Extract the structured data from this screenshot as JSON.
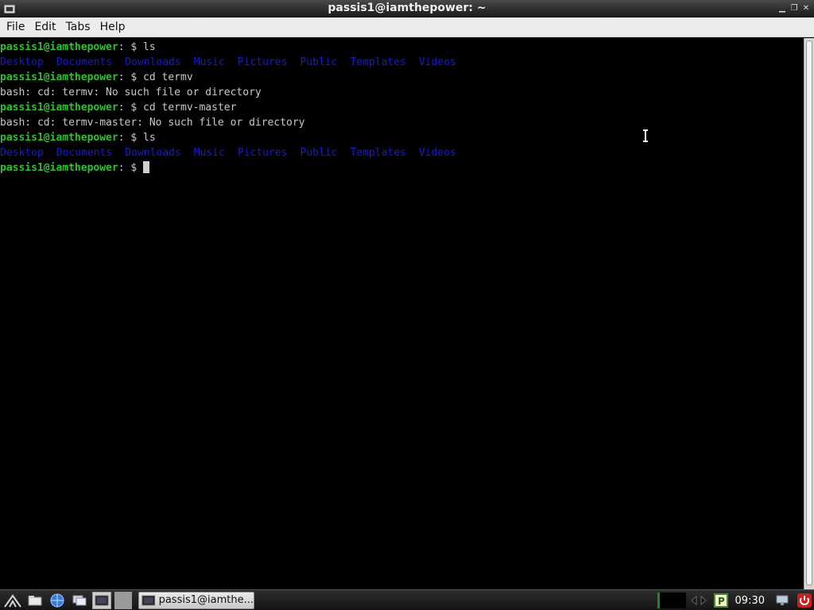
{
  "window": {
    "title": "passis1@iamthepower: ~"
  },
  "menu": [
    "File",
    "Edit",
    "Tabs",
    "Help"
  ],
  "terminal": {
    "prompt_user": "passis1@iamthepower",
    "prompt_sep": ": $ ",
    "commands": {
      "c1": "ls",
      "c2": "cd termv",
      "c3": "cd termv-master",
      "c4": "ls"
    },
    "errors": {
      "e1": "bash: cd: termv: No such file or directory",
      "e2": "bash: cd: termv-master: No such file or directory"
    },
    "dirs": [
      "Desktop",
      "Documents",
      "Downloads",
      "Music",
      "Pictures",
      "Public",
      "Templates",
      "Videos"
    ],
    "colors": {
      "prompt": "#2fc22f",
      "dir": "#1a1ad0",
      "text": "#c8c8c8"
    }
  },
  "taskbar": {
    "task_label": "passis1@iamthe...",
    "clock": "09:30",
    "icons": [
      "start-menu-icon",
      "file-manager-icon",
      "browser-icon",
      "desktop-icon",
      "terminal-icon",
      "pager-icon",
      "power-icon"
    ]
  }
}
